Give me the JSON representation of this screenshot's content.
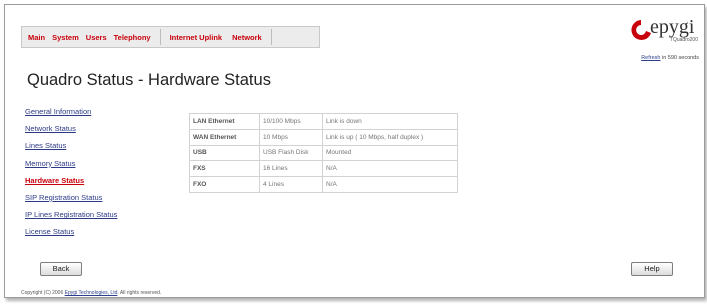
{
  "menu": {
    "items": [
      "Main",
      "System",
      "Users",
      "Telephony",
      "Internet Uplink",
      "Network"
    ]
  },
  "brand": {
    "logo_text": "epygi",
    "model": "TQuadro200"
  },
  "refresh": {
    "link": "Refresh",
    "suffix": " in 590 seconds"
  },
  "page": {
    "title": "Quadro Status - Hardware Status"
  },
  "sidebar": {
    "items": [
      {
        "label": "General Information"
      },
      {
        "label": "Network Status"
      },
      {
        "label": "Lines Status"
      },
      {
        "label": "Memory Status"
      },
      {
        "label": "Hardware Status"
      },
      {
        "label": "SIP Registration Status"
      },
      {
        "label": "IP Lines Registration Status"
      },
      {
        "label": "License Status"
      }
    ],
    "active": "Hardware Status"
  },
  "hardware_table": {
    "rows": [
      {
        "name": "LAN Ethernet",
        "value": "10/100 Mbps",
        "status": "Link is down"
      },
      {
        "name": "WAN Ethernet",
        "value": "10 Mbps",
        "status": "Link is up ( 10 Mbps, half duplex )"
      },
      {
        "name": "USB",
        "value": "USB Flash Disk",
        "status": "Mounted"
      },
      {
        "name": "FXS",
        "value": "16 Lines",
        "status": "N/A"
      },
      {
        "name": "FXO",
        "value": "4 Lines",
        "status": "N/A"
      }
    ]
  },
  "buttons": {
    "back": "Back",
    "help": "Help"
  },
  "footer": {
    "prefix": "Copyright (C) 2006 ",
    "company": "Epygi Technologies, Ltd",
    "suffix": ". All rights reserved."
  },
  "colors": {
    "menu_text": "#c8000b",
    "link": "#2c3a85",
    "active_link": "#c8000b"
  }
}
